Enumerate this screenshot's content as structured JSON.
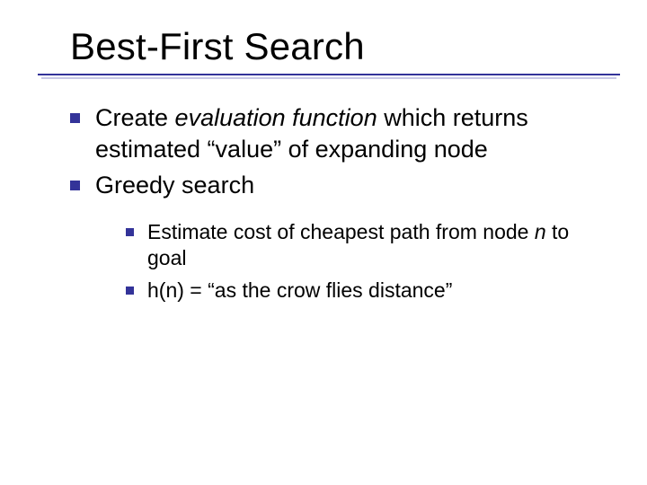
{
  "title": "Best-First Search",
  "bullets": {
    "b1": {
      "pre": "Create ",
      "em": "evaluation function",
      "post": " which returns estimated “value” of expanding node"
    },
    "b2": {
      "text": "Greedy search"
    },
    "sub1": {
      "pre": "Estimate cost of cheapest path from node ",
      "em": "n",
      "post": " to goal"
    },
    "sub2": {
      "text": "h(n) = “as the crow flies distance”"
    }
  }
}
